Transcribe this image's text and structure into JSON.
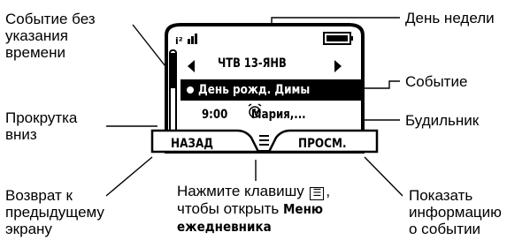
{
  "callouts": {
    "no_time_event": "Событие без\nуказания\nвремени",
    "scroll_down": "Прокрутка\nвниз",
    "weekday": "День недели",
    "event": "Событие",
    "alarm": "Будильник",
    "back": "Возврат к\nпредыдущему\nэкрану",
    "show_info": "Показать\nинформацию\nо событии"
  },
  "bottom_note": {
    "line1": "Нажмите клавишу",
    "menu_key_glyph": "☰",
    "line1_end": ",",
    "line2": "чтобы открыть",
    "menu_name_1": "Меню",
    "menu_name_2": "ежедневника"
  },
  "screen": {
    "date": "ЧТВ 13-ЯНВ",
    "event_selected": "День рожд. Димы",
    "event_timed": "9:00",
    "event_timed_name": "Мария,..."
  },
  "softkeys": {
    "left": "НАЗАД",
    "right": "ПРОСМ."
  },
  "colors": {
    "ink": "#000000",
    "paper": "#ffffff",
    "highlight": "#000000"
  }
}
